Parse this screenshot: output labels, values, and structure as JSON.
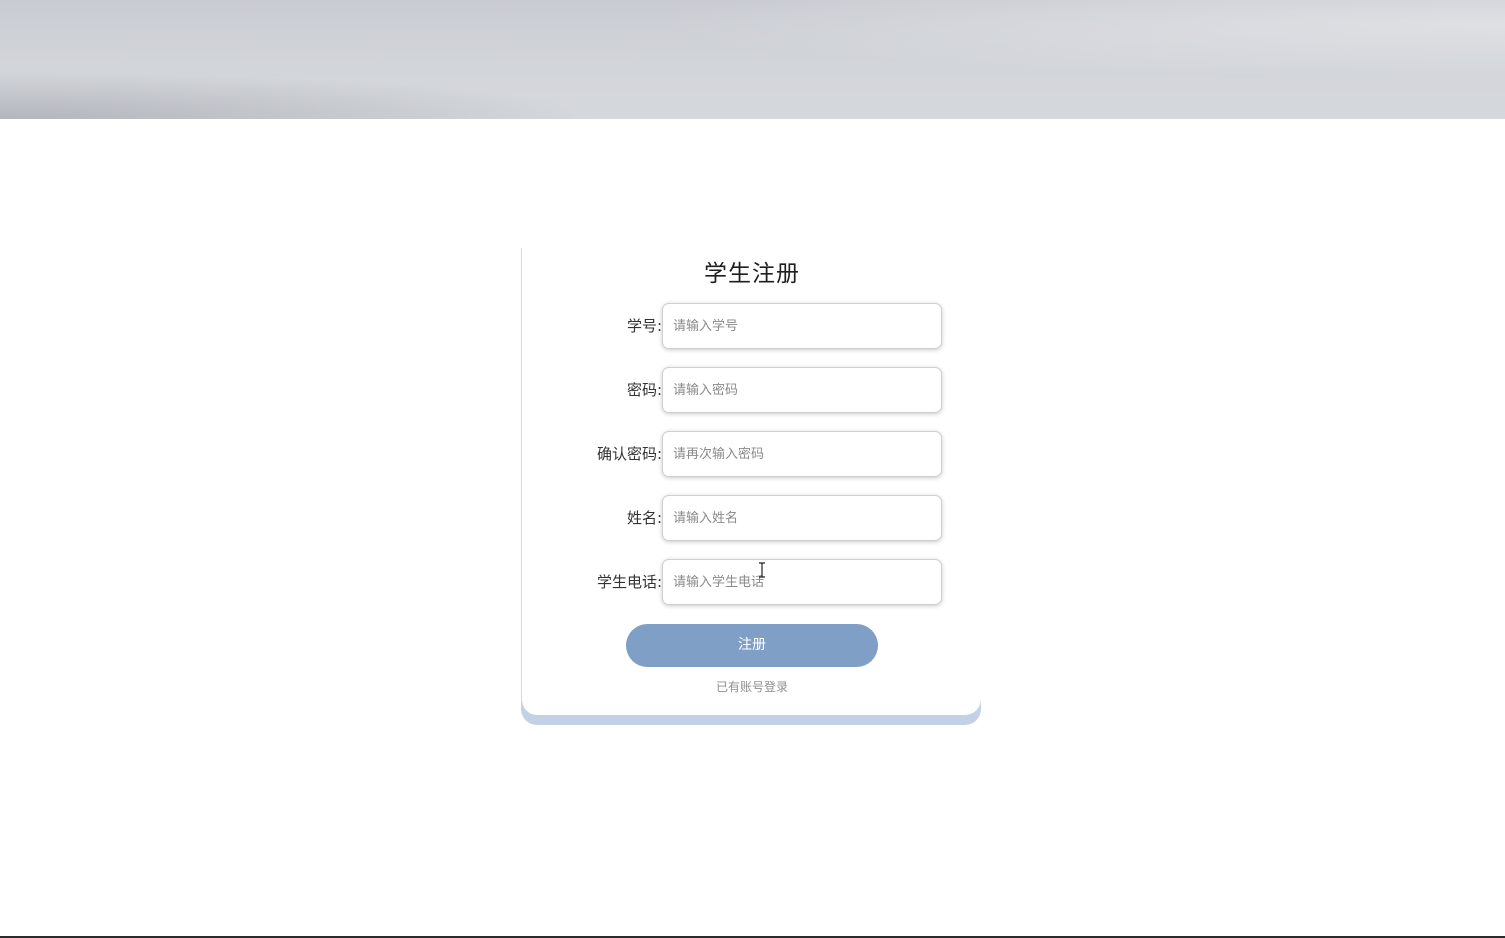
{
  "form": {
    "title": "学生注册",
    "fields": [
      {
        "label": "学号:",
        "placeholder": "请输入学号"
      },
      {
        "label": "密码:",
        "placeholder": "请输入密码"
      },
      {
        "label": "确认密码:",
        "placeholder": "请再次输入密码"
      },
      {
        "label": "姓名:",
        "placeholder": "请输入姓名"
      },
      {
        "label": "学生电话:",
        "placeholder": "请输入学生电话"
      }
    ],
    "submit_label": "注册",
    "login_link": "已有账号登录"
  },
  "colors": {
    "button": "#7f9fc6",
    "card_accent": "#c3d1e6",
    "banner": "#d2d5da"
  }
}
